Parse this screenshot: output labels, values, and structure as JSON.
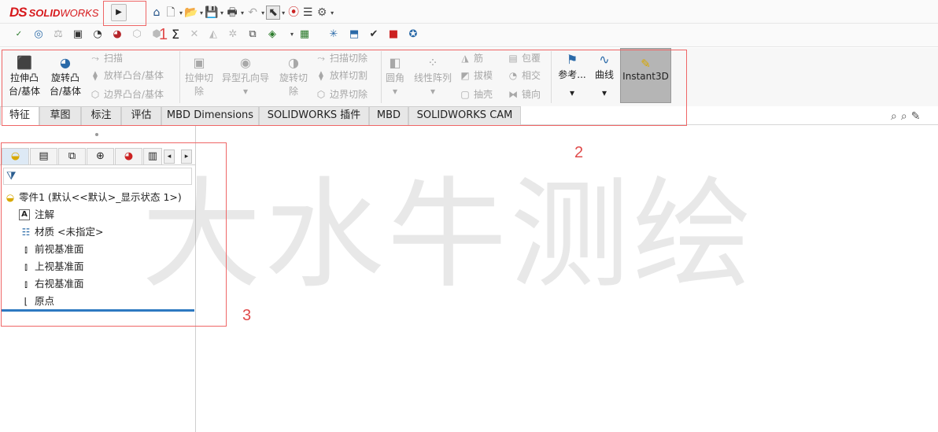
{
  "app": {
    "brand_mark": "DS",
    "brand_bold": "SOLID",
    "brand_light": "WORKS"
  },
  "titlebar": {
    "expand_arrow": "▶",
    "quick_access_icons": [
      "home-icon",
      "new-document-icon",
      "open-folder-icon",
      "save-icon",
      "print-icon",
      "undo-icon",
      "select-cursor-icon",
      "rebuild-traffic-light-icon",
      "file-properties-icon",
      "options-gear-icon"
    ]
  },
  "ribbon": {
    "extrude_boss": [
      "拉伸凸",
      "台/基体"
    ],
    "revolve_boss": [
      "旋转凸",
      "台/基体"
    ],
    "sweep": "扫描",
    "loft": "放样凸台/基体",
    "boundary_boss": "边界凸台/基体",
    "extrude_cut": [
      "拉伸切",
      "除"
    ],
    "hole_wizard": "异型孔向导",
    "revolve_cut": [
      "旋转切",
      "除"
    ],
    "swept_cut": "扫描切除",
    "lofted_cut": "放样切割",
    "boundary_cut": "边界切除",
    "fillet": "圆角",
    "linear_pattern": "线性阵列",
    "rib": "筋",
    "draft": "拔模",
    "shell": "抽壳",
    "wrap": "包覆",
    "intersect": "相交",
    "mirror": "镜向",
    "reference": "参考...",
    "curves": "曲线",
    "instant3d": "Instant3D",
    "dropdown": "▾"
  },
  "tabs": [
    {
      "label": "特征",
      "active": true
    },
    {
      "label": "草图"
    },
    {
      "label": "标注"
    },
    {
      "label": "评估"
    },
    {
      "label": "MBD Dimensions"
    },
    {
      "label": "SOLIDWORKS 插件"
    },
    {
      "label": "MBD"
    },
    {
      "label": "SOLIDWORKS CAM"
    }
  ],
  "feature_tree": {
    "root": "零件1 (默认<<默认>_显示状态 1>)",
    "items": [
      "注解",
      "材质 <未指定>",
      "前视基准面",
      "上视基准面",
      "右视基准面",
      "原点"
    ]
  },
  "annotations": {
    "one": "1",
    "two": "2",
    "three": "3",
    "color": "#e04b4b"
  },
  "watermark": "大水牛测绘",
  "colors": {
    "brand_red": "#d7191c",
    "selection_blue": "#2d79c1",
    "instant3d_bg": "#b5b5b5"
  }
}
